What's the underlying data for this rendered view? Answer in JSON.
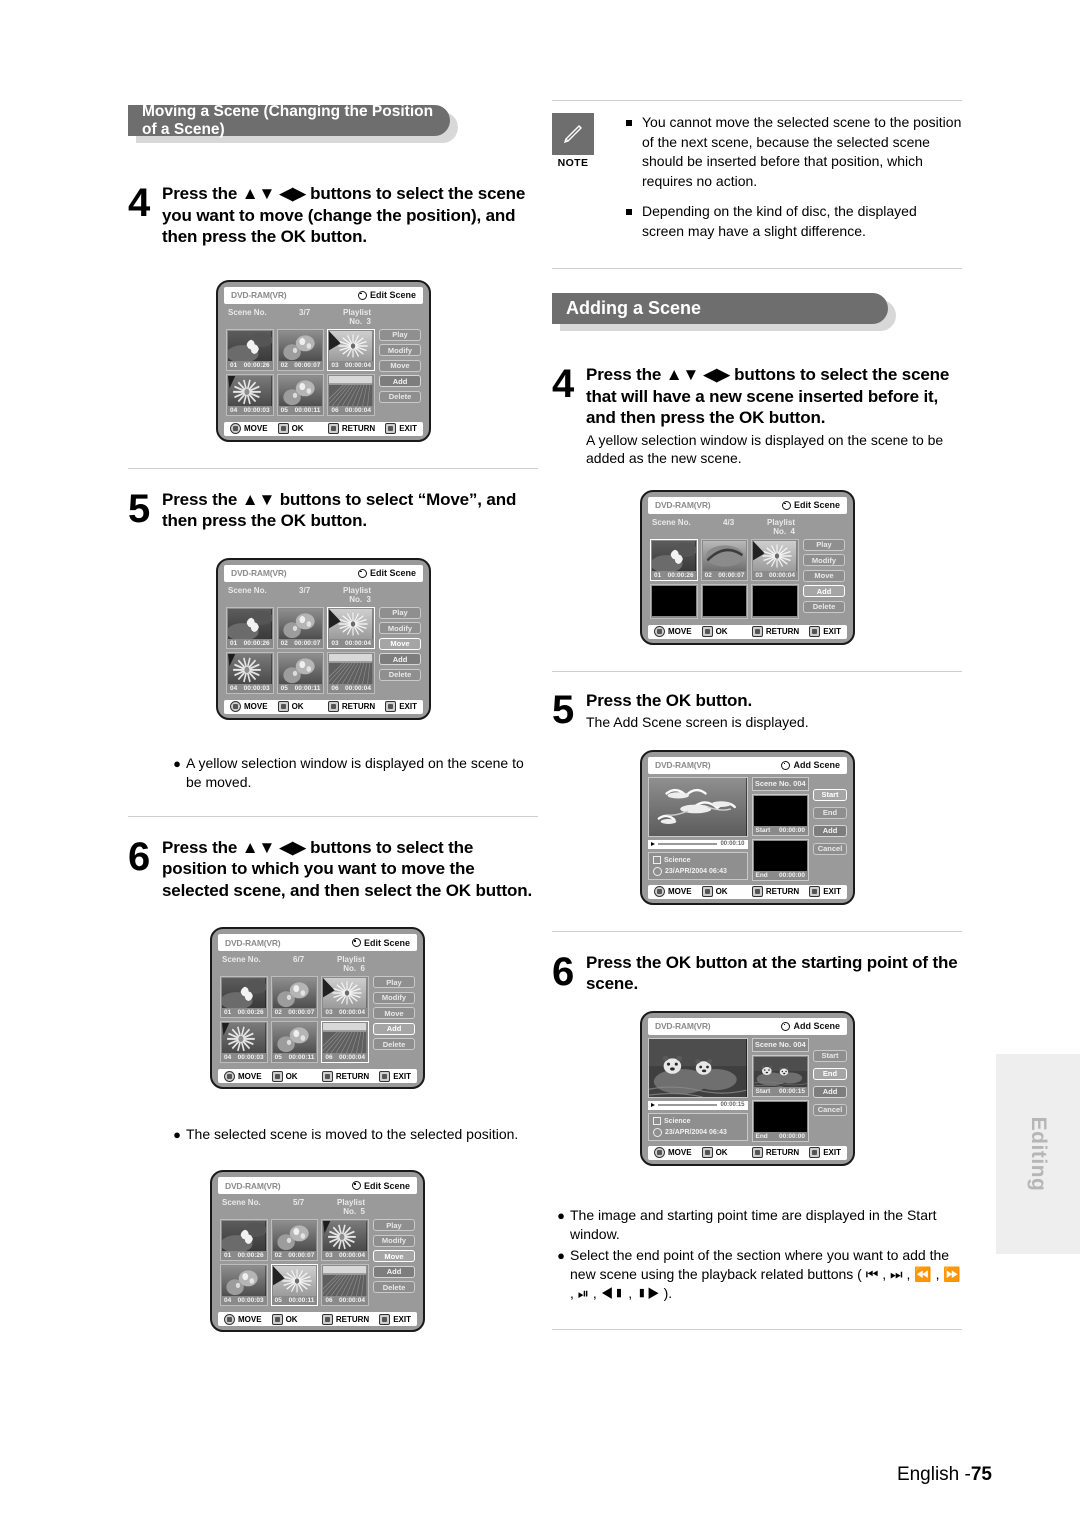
{
  "page": {
    "footer_lang": "English -",
    "footer_page": "75",
    "side_tab": "Editing"
  },
  "left": {
    "section_title": "Moving a Scene (Changing the Position of a Scene)",
    "step4": {
      "num": "4",
      "text": "Press the ▲▼ ◀▶ buttons to select the scene you want to move (change the position), and then press the OK button."
    },
    "step5": {
      "num": "5",
      "text": "Press the ▲▼ buttons to select “Move”, and then press the OK button."
    },
    "step5_bullet": "A yellow selection window is displayed on the scene to be moved.",
    "step6": {
      "num": "6",
      "text": "Press the ▲▼ ◀▶ buttons to select the position to which you want to move the selected scene, and then select the OK button."
    },
    "step6_bullet": "The selected scene is moved to the selected position."
  },
  "right": {
    "note": {
      "label": "NOTE",
      "items": [
        "You cannot move the selected scene to the position of the next scene, because the selected scene should be inserted before that position, which requires no action.",
        "Depending on the kind of disc, the displayed screen may have a slight difference."
      ]
    },
    "section_title": "Adding a Scene",
    "step4": {
      "num": "4",
      "head": "Press the ▲▼ ◀▶ buttons to select the scene that will have a new scene inserted before it, and then press the OK button.",
      "sub": "A yellow selection window is displayed on the scene to be added as the new scene."
    },
    "step5": {
      "num": "5",
      "head": "Press the OK button.",
      "sub": "The Add Scene screen is displayed."
    },
    "step6": {
      "num": "6",
      "head": "Press the OK button at the starting point of the scene."
    },
    "bullets": [
      "The image and starting point time are displayed in the Start window.",
      "Select the end point of the section where you want to add the new scene using the playback related buttons ( ⏮ , ⏭ , ⏪ , ⏩ , ⏯ , ◀▮ , ▮▶ )."
    ]
  },
  "screens": {
    "edit_scene_label": "Edit Scene",
    "add_scene_label": "Add Scene",
    "disc": "DVD-RAM(VR)",
    "scene_no_label": "Scene No.",
    "playlist_label": "Playlist No.",
    "footer": {
      "move": "MOVE",
      "ok": "OK",
      "return": "RETURN",
      "exit": "EXIT"
    },
    "side_buttons": [
      "Play",
      "Modify",
      "Move",
      "Add",
      "Delete"
    ],
    "add_buttons": [
      "Start",
      "End",
      "Add",
      "Cancel"
    ],
    "s1": {
      "counter": "3/7",
      "playlist": "3",
      "selected_index": 2,
      "hl_button": -1,
      "cells": [
        {
          "no": "01",
          "time": "00:00:26"
        },
        {
          "no": "02",
          "time": "00:00:07"
        },
        {
          "no": "03",
          "time": "00:00:04"
        },
        {
          "no": "04",
          "time": "00:00:03"
        },
        {
          "no": "05",
          "time": "00:00:11"
        },
        {
          "no": "06",
          "time": "00:00:04"
        }
      ]
    },
    "s2": {
      "counter": "3/7",
      "playlist": "3",
      "selected_index": 2,
      "hl_button": 2,
      "cells": [
        {
          "no": "01",
          "time": "00:00:26"
        },
        {
          "no": "02",
          "time": "00:00:07"
        },
        {
          "no": "03",
          "time": "00:00:04"
        },
        {
          "no": "04",
          "time": "00:00:03"
        },
        {
          "no": "05",
          "time": "00:00:11"
        },
        {
          "no": "06",
          "time": "00:00:04"
        }
      ]
    },
    "s3": {
      "counter": "6/7",
      "playlist": "6",
      "selected_index": 5,
      "hl_button": 3,
      "cells": [
        {
          "no": "01",
          "time": "00:00:26"
        },
        {
          "no": "02",
          "time": "00:00:07"
        },
        {
          "no": "03",
          "time": "00:00:04"
        },
        {
          "no": "04",
          "time": "00:00:03"
        },
        {
          "no": "05",
          "time": "00:00:11"
        },
        {
          "no": "06",
          "time": "00:00:04"
        }
      ]
    },
    "s4": {
      "counter": "5/7",
      "playlist": "5",
      "selected_index": 4,
      "hl_button": 2,
      "cells": [
        {
          "no": "01",
          "time": "00:00:26"
        },
        {
          "no": "02",
          "time": "00:00:07"
        },
        {
          "no": "03",
          "time": "00:00:04"
        },
        {
          "no": "04",
          "time": "00:00:03"
        },
        {
          "no": "05",
          "time": "00:00:11"
        },
        {
          "no": "06",
          "time": "00:00:04"
        }
      ]
    },
    "s5": {
      "counter": "4/3",
      "playlist": "4",
      "selected_index": 0,
      "hl_button": 3,
      "cells": [
        {
          "no": "01",
          "time": "00:00:26"
        },
        {
          "no": "02",
          "time": "00:00:07"
        },
        {
          "no": "03",
          "time": "00:00:04"
        },
        {
          "no": "",
          "time": ""
        },
        {
          "no": "",
          "time": ""
        },
        {
          "no": "",
          "time": ""
        }
      ]
    },
    "add1": {
      "scene_no": "Scene No. 004",
      "elapsed": "00:00:10",
      "title": "Science",
      "date": "23/APR/2004 06:43",
      "start_label": "Start",
      "start_time": "00:00:00",
      "end_label": "End",
      "end_time": "00:00:00",
      "hl_button": 0
    },
    "add2": {
      "scene_no": "Scene No. 004",
      "elapsed": "00:00:15",
      "title": "Science",
      "date": "23/APR/2004 06:43",
      "start_label": "Start",
      "start_time": "00:00:15",
      "end_label": "End",
      "end_time": "00:00:00",
      "hl_button": 1
    }
  }
}
